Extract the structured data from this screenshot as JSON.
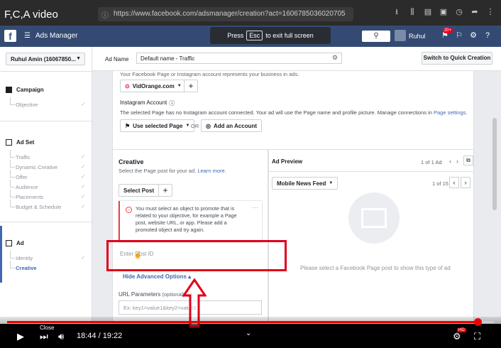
{
  "video": {
    "title": "F,C,A video",
    "close_label": "Close",
    "time_current": "18:44",
    "time_total": "19:22",
    "progress_fraction": 0.967,
    "hd_badge": "HD"
  },
  "browser": {
    "url": "https://www.facebook.com/adsmanager/creation?act=1606785036020705"
  },
  "fb": {
    "app_name": "Ads Manager",
    "user_name": "Ruhul",
    "notification_badge": "20+",
    "fullscreen_notice_pre": "Press",
    "fullscreen_key": "Esc",
    "fullscreen_notice_post": "to exit full screen"
  },
  "sidebar": {
    "account": "Ruhul Amin (16067850...",
    "campaign": {
      "label": "Campaign",
      "items": [
        "Objective"
      ]
    },
    "adset": {
      "label": "Ad Set",
      "items": [
        "Traffic",
        "Dynamic Creative",
        "Offer",
        "Audience",
        "Placements",
        "Budget & Schedule"
      ]
    },
    "ad": {
      "label": "Ad",
      "items": [
        "Identity",
        "Creative"
      ]
    }
  },
  "adname": {
    "label": "Ad Name",
    "value": "Default name - Traffic",
    "quick_button": "Switch to Quick Creation"
  },
  "identity": {
    "top_note": "Your Facebook Page or Instagram account represents your business in ads.",
    "page_select": "VidOrange.com",
    "instagram_label": "Instagram Account",
    "instagram_note": "The selected Page has no Instagram account connected. Your ad will use the Page name and profile picture. Manage connections in",
    "page_settings_link": "Page settings",
    "use_page_button": "Use selected Page",
    "or_label": "OR",
    "add_account_button": "Add an Account"
  },
  "creative": {
    "title": "Creative",
    "subtitle": "Select the Page post for your ad.",
    "learn_more": "Learn more.",
    "select_post_button": "Select Post",
    "error": "You must select an object to promote that is related to your objective, for example a Page post, website URL, or app. Please add a promoted object and try again.",
    "post_id_placeholder": "Enter Post ID",
    "advanced_toggle": "Hide Advanced Options ▴",
    "url_params_label": "URL Parameters",
    "url_params_optional": "(optional)",
    "url_params_placeholder": "Ex: key1=value1&key2=value2"
  },
  "preview": {
    "title": "Ad Preview",
    "ad_count": "1 of 1 Ad",
    "placement": "Mobile News Feed",
    "page_count": "1 of 15",
    "empty_message": "Please select a Facebook Page post to show this type of ad"
  },
  "colors": {
    "fb_blue": "#4267b2",
    "error_red": "#fa3e3e",
    "annotation_red": "#e0001a",
    "progress_red": "#e00000"
  }
}
